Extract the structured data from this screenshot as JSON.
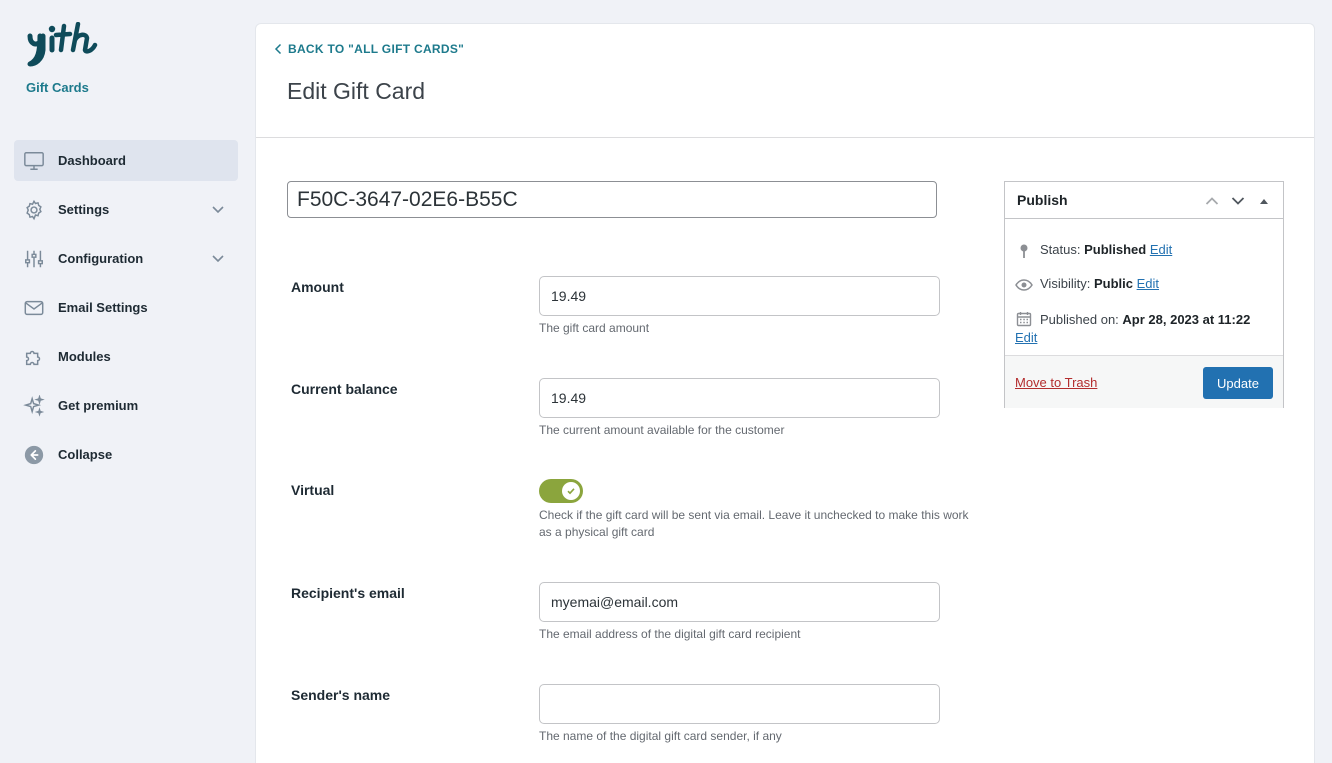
{
  "brand": {
    "logo_text": "yith",
    "subtitle": "Gift Cards"
  },
  "sidebar": {
    "items": [
      {
        "label": "Dashboard",
        "icon": "monitor-icon",
        "active": true
      },
      {
        "label": "Settings",
        "icon": "gear-icon",
        "expandable": true
      },
      {
        "label": "Configuration",
        "icon": "sliders-icon",
        "expandable": true
      },
      {
        "label": "Email Settings",
        "icon": "envelope-icon"
      },
      {
        "label": "Modules",
        "icon": "puzzle-icon"
      },
      {
        "label": "Get premium",
        "icon": "sparkle-icon"
      },
      {
        "label": "Collapse",
        "icon": "arrow-left-circle-icon"
      }
    ]
  },
  "header": {
    "back_label": "BACK TO \"ALL GIFT CARDS\"",
    "title": "Edit Gift Card"
  },
  "card": {
    "code": "F50C-3647-02E6-B55C"
  },
  "fields": {
    "amount": {
      "label": "Amount",
      "value": "19.49",
      "description": "The gift card amount"
    },
    "balance": {
      "label": "Current balance",
      "value": "19.49",
      "description": "The current amount available for the customer"
    },
    "virtual": {
      "label": "Virtual",
      "checked": true,
      "description": "Check if the gift card will be sent via email. Leave it unchecked to make this work as a physical gift card"
    },
    "recipient": {
      "label": "Recipient's email",
      "value": "myemai@email.com",
      "description": "The email address of the digital gift card recipient"
    },
    "sender": {
      "label": "Sender's name",
      "value": "",
      "description": "The name of the digital gift card sender, if any"
    }
  },
  "publish": {
    "title": "Publish",
    "status_label": "Status:",
    "status_value": "Published",
    "visibility_label": "Visibility:",
    "visibility_value": "Public",
    "published_label": "Published on:",
    "published_value": "Apr 28, 2023 at 11:22",
    "edit_label": "Edit",
    "trash_label": "Move to Trash",
    "update_label": "Update"
  },
  "colors": {
    "accent": "#1d7a8c",
    "toggle": "#8ba53d",
    "primary_button": "#2271b1",
    "trash": "#b32d2e"
  }
}
